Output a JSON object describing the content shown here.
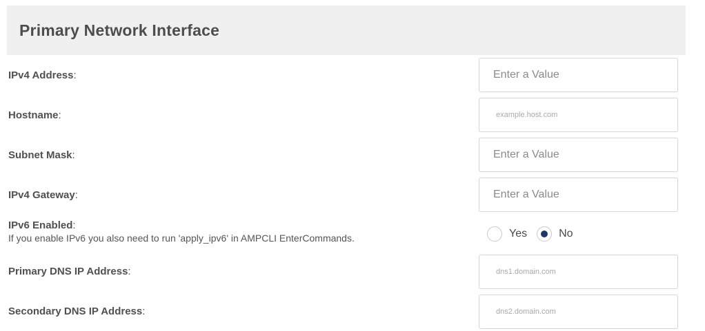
{
  "panel": {
    "title": "Primary Network Interface"
  },
  "fields": {
    "ipv4_address": {
      "label": "IPv4 Address",
      "placeholder": "Enter a Value",
      "value": ""
    },
    "hostname": {
      "label": "Hostname",
      "placeholder": "example.host.com",
      "value": ""
    },
    "subnet_mask": {
      "label": "Subnet Mask",
      "placeholder": "Enter a Value",
      "value": ""
    },
    "ipv4_gateway": {
      "label": "IPv4 Gateway",
      "placeholder": "Enter a Value",
      "value": ""
    },
    "ipv6_enabled": {
      "label": "IPv6 Enabled",
      "note": "If you enable IPv6 you also need to run 'apply_ipv6' in AMPCLI EnterCommands.",
      "options": [
        "Yes",
        "No"
      ],
      "selected": "No"
    },
    "primary_dns": {
      "label": "Primary DNS IP Address",
      "placeholder": "dns1.domain.com",
      "value": ""
    },
    "secondary_dns": {
      "label": "Secondary DNS IP Address",
      "placeholder": "dns2.domain.com",
      "value": ""
    }
  },
  "colon": ":"
}
